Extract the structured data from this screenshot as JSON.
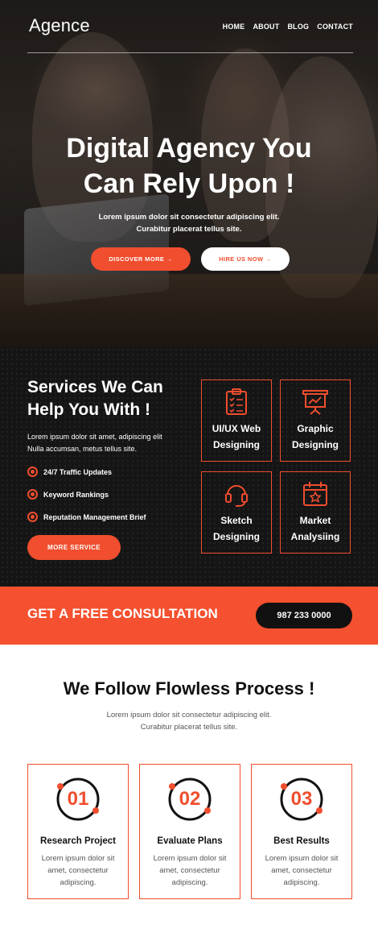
{
  "header": {
    "logo": "Agence",
    "nav": [
      "HOME",
      "ABOUT",
      "BLOG",
      "CONTACT"
    ]
  },
  "hero": {
    "title_line1": "Digital Agency You",
    "title_line2": "Can Rely Upon !",
    "subtitle_line1": "Lorem ipsum dolor sit consectetur adipiscing elit.",
    "subtitle_line2": "Curabitur placerat tellus site.",
    "primary_button": "DISCOVER MORE →",
    "secondary_button": "HIRE US NOW →"
  },
  "services": {
    "title_line1": "Services We Can",
    "title_line2": "Help You With !",
    "desc_line1": "Lorem ipsum dolor sit amet, adipiscing elit",
    "desc_line2": "Nulla accumsan, metus tellus site.",
    "features": [
      "24/7 Traffic Updates",
      "Keyword Rankings",
      "Reputation Management Brief"
    ],
    "button": "MORE SERVICE",
    "cards": [
      {
        "line1": "UI/UX Web",
        "line2": "Designing",
        "icon": "checklist-icon"
      },
      {
        "line1": "Graphic",
        "line2": "Designing",
        "icon": "presentation-icon"
      },
      {
        "line1": "Sketch",
        "line2": "Designing",
        "icon": "headset-icon"
      },
      {
        "line1": "Market",
        "line2": "Analysiing",
        "icon": "calendar-star-icon"
      }
    ]
  },
  "cta": {
    "title": "GET A FREE CONSULTATION",
    "phone": "987 233 0000"
  },
  "process": {
    "title": "We Follow Flowless Process !",
    "subtitle_line1": "Lorem ipsum dolor sit consectetur adipiscing elit.",
    "subtitle_line2": "Curabitur placerat tellus site.",
    "steps": [
      {
        "num": "01",
        "title": "Research Project",
        "desc": "Lorem ipsum dolor sit amet, consectetur adipiscing."
      },
      {
        "num": "02",
        "title": "Evaluate Plans",
        "desc": "Lorem ipsum dolor sit amet, consectetur adipiscing."
      },
      {
        "num": "03",
        "title": "Best Results",
        "desc": "Lorem ipsum dolor sit amet, consectetur adipiscing."
      }
    ]
  },
  "colors": {
    "accent": "#f04e2e",
    "dark": "#151515",
    "cta_bg": "#f5502f"
  }
}
